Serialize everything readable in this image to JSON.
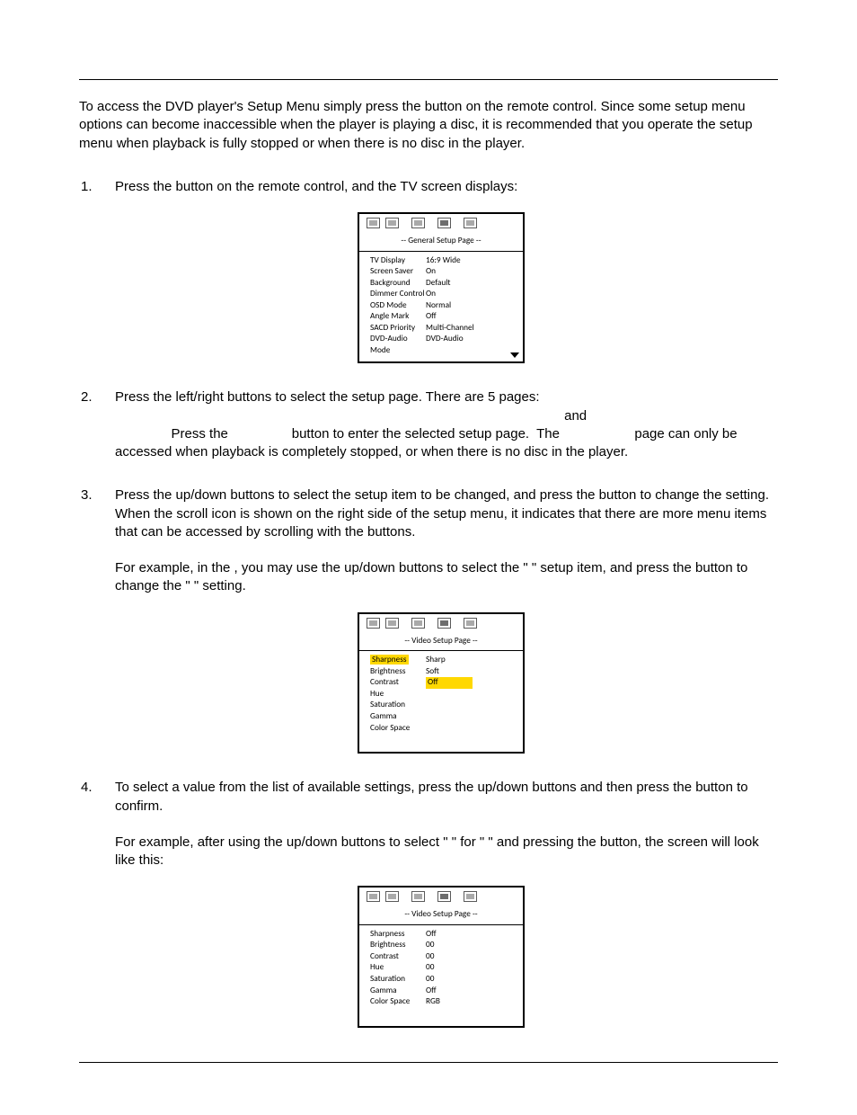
{
  "intro": "To access the DVD player's Setup Menu simply press the            button on the remote control.  Since some setup menu options can become inaccessible when the player is playing a disc, it is recommended that you operate the setup menu when playback is fully stopped or when there is no disc in the player.",
  "steps": {
    "s1": {
      "num": "1.",
      "text": "Press the               button on the remote control, and the TV screen displays:"
    },
    "s2": {
      "num": "2.",
      "line1": "Press the left/right                  buttons to select the setup page.  There are 5 pages:",
      "line2": "                                                                                                                        and",
      "line3": "               Press the                 button to enter the selected setup page.  The                    page can only be accessed when playback is completely stopped, or when there is no disc in the player."
    },
    "s3": {
      "num": "3.",
      "line1": "Press the up/down                   buttons to select the setup item to be changed, and press the                   button to change the setting.  When the scroll icon is shown on the right side of the setup menu, it indicates that there are more menu items that can be accessed by scrolling with the                  buttons.",
      "line2": "For example, in the                                  , you may use the up/down                    buttons to select the \"                 \" setup item, and press the                    button to change the \"                     \" setting."
    },
    "s4": {
      "num": "4.",
      "line1": "To select a value from the list of available settings, press the up/down                    buttons and then press the                  button to confirm.",
      "line2": "For example, after using the up/down                      buttons to select \"       \" for \"                   \" and pressing the                 button, the screen will look like this:"
    }
  },
  "osd1": {
    "title": "-- General Setup Page --",
    "rows": [
      {
        "k": "TV Display",
        "v": "16:9 Wide"
      },
      {
        "k": "Screen Saver",
        "v": "On"
      },
      {
        "k": "Background",
        "v": "Default"
      },
      {
        "k": "Dimmer Control",
        "v": "On"
      },
      {
        "k": "OSD Mode",
        "v": "Normal"
      },
      {
        "k": "Angle Mark",
        "v": "Off"
      },
      {
        "k": "SACD Priority",
        "v": "Multi-Channel"
      },
      {
        "k": "DVD-Audio Mode",
        "v": "DVD-Audio"
      }
    ]
  },
  "osd2": {
    "title": "-- Video Setup Page --",
    "rows": [
      {
        "k": "Sharpness",
        "v": "Sharp",
        "kh": true
      },
      {
        "k": "Brightness",
        "v": "Soft"
      },
      {
        "k": "Contrast",
        "v": "Off",
        "vh": true
      },
      {
        "k": "Hue",
        "v": ""
      },
      {
        "k": "Saturation",
        "v": ""
      },
      {
        "k": "Gamma",
        "v": ""
      },
      {
        "k": "Color Space",
        "v": ""
      }
    ]
  },
  "osd3": {
    "title": "-- Video Setup Page --",
    "rows": [
      {
        "k": "Sharpness",
        "v": "Off"
      },
      {
        "k": "Brightness",
        "v": "00"
      },
      {
        "k": "Contrast",
        "v": "00"
      },
      {
        "k": "Hue",
        "v": "00"
      },
      {
        "k": "Saturation",
        "v": "00"
      },
      {
        "k": "Gamma",
        "v": "Off"
      },
      {
        "k": "Color Space",
        "v": "RGB"
      }
    ]
  }
}
